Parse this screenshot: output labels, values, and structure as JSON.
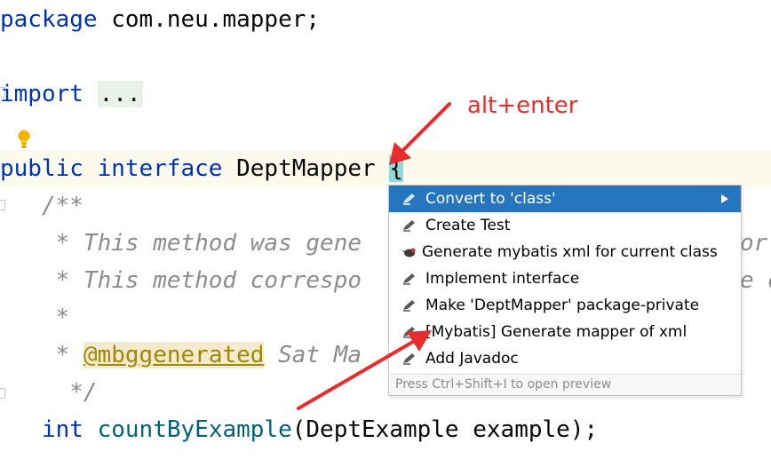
{
  "editor": {
    "line_package": {
      "kw": "package",
      "rest": " com.neu.mapper;"
    },
    "line_import": {
      "kw": "import",
      "folded": "..."
    },
    "line_interface": {
      "kw1": "public",
      "kw2": "interface",
      "name": "DeptMapper",
      "brace": "{"
    },
    "comment_open": "/**",
    "comment_line1": "* This method was gene",
    "comment_line1_tail": "or.",
    "comment_line2": "* This method correspo",
    "comment_line2_tail": "e d",
    "comment_star": "*",
    "comment_anno_prefix": "* ",
    "comment_anno": "@mbggenerated",
    "comment_anno_rest": " Sat Ma",
    "comment_close": "*/",
    "method_line": {
      "type": "int",
      "name": "countByExample",
      "params": "(DeptExample example);"
    }
  },
  "popup": {
    "items": [
      {
        "label": "Convert to 'class'",
        "icon": "pencil-icon",
        "selected": true,
        "submenu": true
      },
      {
        "label": "Create Test",
        "icon": "pencil-icon"
      },
      {
        "label": "Generate mybatis xml for current class",
        "icon": "bird-icon"
      },
      {
        "label": "Implement interface",
        "icon": "pencil-icon"
      },
      {
        "label": "Make 'DeptMapper' package-private",
        "icon": "pencil-icon"
      },
      {
        "label": "[Mybatis] Generate mapper of xml",
        "icon": "pencil-icon"
      },
      {
        "label": "Add Javadoc",
        "icon": "pencil-icon"
      }
    ],
    "hint": "Press Ctrl+Shift+I to open preview"
  },
  "annotation": {
    "label": "alt+enter",
    "color": "#e82c2c"
  },
  "colors": {
    "keyword": "#0033b3",
    "comment": "#8c8c8c",
    "method": "#00627a",
    "selection": "#2675bf"
  }
}
